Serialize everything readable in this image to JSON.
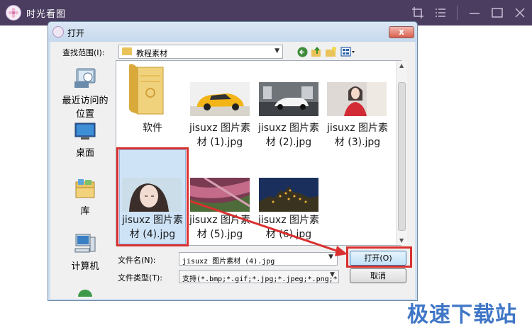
{
  "app": {
    "title": "时光看图",
    "icons": [
      "crop-icon",
      "list-icon",
      "minimize-icon",
      "maximize-icon",
      "close-icon"
    ]
  },
  "dialog": {
    "title": "打开",
    "close_glyph": "x",
    "look_in_label": "查找范围(I):",
    "look_in_value": "教程素材",
    "places": [
      {
        "label": "最近访问的\n位置",
        "icon": "recent-places-icon"
      },
      {
        "label": "桌面",
        "icon": "desktop-icon"
      },
      {
        "label": "库",
        "icon": "libraries-icon"
      },
      {
        "label": "计算机",
        "icon": "computer-icon"
      }
    ],
    "files": [
      {
        "name": "软件",
        "type": "folder"
      },
      {
        "name": "jisuxz 图片素材 (1).jpg",
        "type": "image",
        "thumb": "yellow-car"
      },
      {
        "name": "jisuxz 图片素材 (2).jpg",
        "type": "image",
        "thumb": "white-car"
      },
      {
        "name": "jisuxz 图片素材 (3).jpg",
        "type": "image",
        "thumb": "woman-red"
      },
      {
        "name": "jisuxz 图片素材 (4).jpg",
        "type": "image",
        "thumb": "woman-portrait",
        "selected": true
      },
      {
        "name": "jisuxz 图片素材 (5).jpg",
        "type": "image",
        "thumb": "pink-field"
      },
      {
        "name": "jisuxz 图片素材 (6).jpg",
        "type": "image",
        "thumb": "night-castle"
      }
    ],
    "filename_label": "文件名(N):",
    "filename_value": "jisuxz 图片素材 (4).jpg",
    "filetype_label": "文件类型(T):",
    "filetype_value": "支持(*.bmp;*.gif;*.jpg;*.jpeg;*.png;*",
    "open_button": "打开(O)",
    "cancel_button": "取消"
  },
  "watermark": "极速下载站",
  "colors": {
    "titlebar": "#4a3d5f",
    "annotation_red": "#d9302f",
    "watermark_blue": "#3f76c6"
  }
}
